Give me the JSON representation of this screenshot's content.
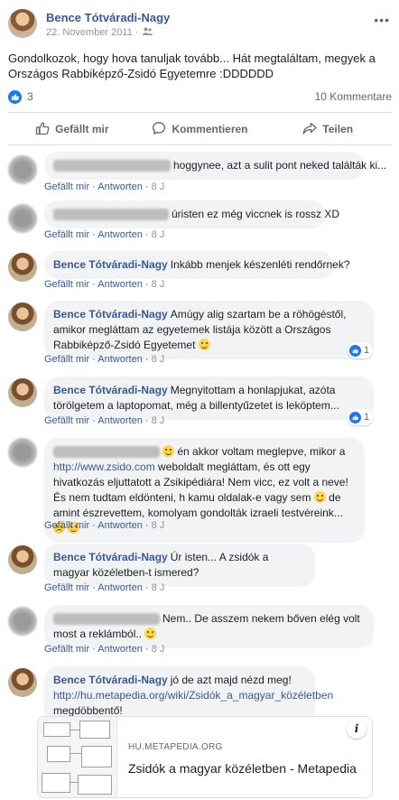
{
  "post": {
    "author": "Bence Tótváradi-Nagy",
    "date": "22. November 2011 · ",
    "text": "Gondolkozok, hogy hova tanuljak tovább... Hát megtaláltam, megyek a Országos Rabbiképző-Zsidó Egyetemre :DDDDDD",
    "reaction_count": "3",
    "comment_count": "10 Kommentare"
  },
  "actions": {
    "like": "Gefällt mir",
    "comment": "Kommentieren",
    "share": "Teilen"
  },
  "comment_actions": {
    "like": "Gefällt mir",
    "reply": "Antworten",
    "time": "8 J"
  },
  "comments": [
    {
      "author": "",
      "text": "hoggynee, azt a sulit pont neked találták ki..."
    },
    {
      "author": "",
      "text": "úristen ez még viccnek is rossz XD"
    },
    {
      "author": "Bence Tótváradi-Nagy",
      "text": "Inkább menjek készenléti rendőrnek?"
    },
    {
      "author": "Bence Tótváradi-Nagy",
      "text": "Amúgy alig szartam be a röhögéstől, amikor megláttam az egyetemek listája között a Országos Rabbiképző-Zsidó Egyetemet",
      "reactions": "1"
    },
    {
      "author": "Bence Tótváradi-Nagy",
      "text": "Megnyitottam a honlapjukat, azóta törölgetem a laptopomat, még a billentyűzetet is leköptem...",
      "reactions": "1"
    },
    {
      "author": "",
      "text_a": " én akkor voltam meglepve, mikor a ",
      "link": "http://www.zsido.com",
      "text_b": " weboldalt megláttam, és ott egy hivatkozás eljuttatott a Zsikipédiára! Nem vicc, ez volt a neve! És nem tudtam eldönteni, h kamu oldalak-e vagy sem ",
      "text_c": " de amint észrevettem, komolyam gondolták izraeli testvéreink... "
    },
    {
      "author": "Bence Tótváradi-Nagy",
      "text": "Úr isten... A zsidók a magyar közéletben-t ismered?"
    },
    {
      "author": "",
      "text": "Nem.. De asszem nekem bőven elég volt most a reklámból.. "
    },
    {
      "author": "Bence Tótváradi-Nagy",
      "text": "jó de azt majd nézd meg!",
      "link": "http://hu.metapedia.org/wiki/Zsidók_a_magyar_közéletben",
      "text_after": " megdöbbentő!"
    }
  ],
  "link_preview": {
    "domain": "HU.METAPEDIA.ORG",
    "title": "Zsidók a magyar közéletben - Metapedia"
  },
  "icons": {
    "more": "more-options-icon",
    "audience": "friends-audience-icon",
    "like_reaction": "like-reaction-icon",
    "thumbs_up": "thumbs-up-icon",
    "comment": "comment-icon",
    "share": "share-icon",
    "info": "info-icon"
  },
  "colors": {
    "link": "#385898",
    "like_blue": "#1877f2",
    "bubble": "#f2f3f5"
  }
}
